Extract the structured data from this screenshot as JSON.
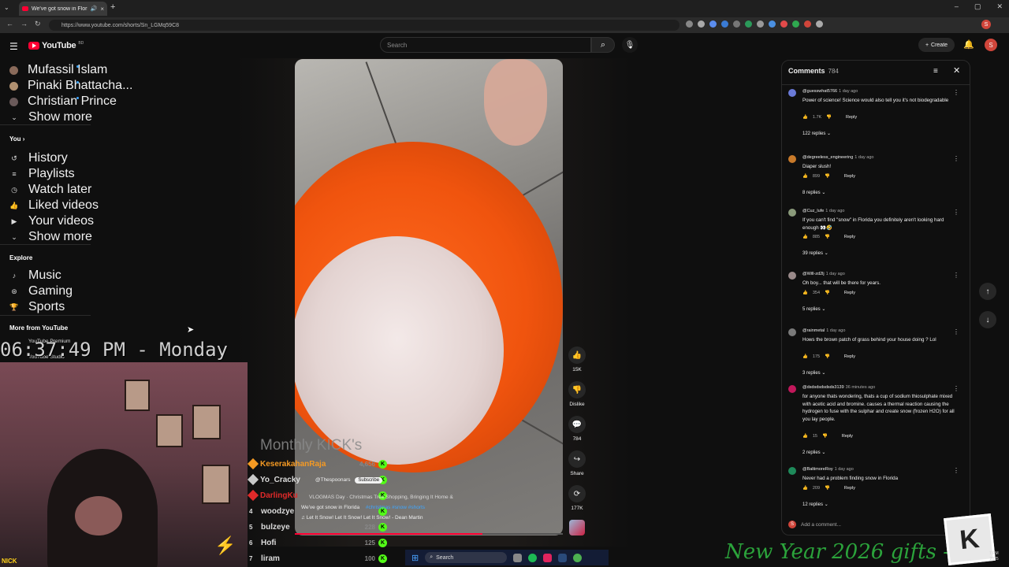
{
  "browser": {
    "tab_title": "We've got snow in Florida",
    "url": "https://www.youtube.com/shorts/Sn_LGMq59C8",
    "new_tab_icon": "plus",
    "profile_initial": "S"
  },
  "header": {
    "logo_text": "YouTube",
    "logo_country": "BD",
    "search_placeholder": "Search",
    "create_label": "Create",
    "avatar_initial": "S"
  },
  "sidebar": {
    "subscriptions": [
      {
        "name": "Mufassil Islam"
      },
      {
        "name": "Pinaki Bhattacha..."
      },
      {
        "name": "Christian Prince"
      }
    ],
    "show_more": "Show more",
    "you_heading": "You",
    "you_items": [
      {
        "label": "History",
        "icon": "history-icon"
      },
      {
        "label": "Playlists",
        "icon": "playlist-icon"
      },
      {
        "label": "Watch later",
        "icon": "clock-icon"
      },
      {
        "label": "Liked videos",
        "icon": "thumbs-up-icon"
      },
      {
        "label": "Your videos",
        "icon": "video-icon"
      }
    ],
    "show_more_2": "Show more",
    "explore_heading": "Explore",
    "explore_items": [
      {
        "label": "Music",
        "icon": "music-icon"
      },
      {
        "label": "Gaming",
        "icon": "gamepad-icon"
      },
      {
        "label": "Sports",
        "icon": "trophy-icon"
      }
    ],
    "more_heading": "More from YouTube",
    "more_items": [
      {
        "label": "YouTube Premium"
      },
      {
        "label": "YouTube Studio"
      }
    ]
  },
  "video": {
    "channel": "@Thespoonars",
    "subscribe": "Subscribe",
    "title": "We've got snow in Florida",
    "hashtags": "#christmas #snow #shorts",
    "playlist_line": "VLOGMAS Day · Christmas Tree Shopping, Bringing It Home &",
    "music": "Let It Snow! Let It Snow! Let It Snow! - Dean Martin",
    "progress": 0.7
  },
  "actions": {
    "like_count": "15K",
    "dislike_label": "Dislike",
    "comment_count": "784",
    "share_label": "Share",
    "remix_count": "177K"
  },
  "comments": {
    "title": "Comments",
    "count": "784",
    "add_placeholder": "Add a comment...",
    "items": [
      {
        "author": "@guesswhat5766",
        "ago": "1 day ago",
        "text": "Power of science! Science would also tell you it's not biodegradable",
        "likes": "1.7K",
        "replies": "122 replies",
        "avatar": "#6a7ad8"
      },
      {
        "author": "@degreeless_engineering",
        "ago": "1 day ago",
        "text": "Diaper slush!",
        "likes": "899",
        "replies": "8 replies",
        "avatar": "#c87a2a"
      },
      {
        "author": "@Cuz_lufe",
        "ago": "1 day ago",
        "text": "If you can't find \"snow\" in Florida you definitely aren't looking hard enough 👀🤣",
        "likes": "885",
        "replies": "39 replies",
        "avatar": "#8a9a7a"
      },
      {
        "author": "@Will-zd2lj",
        "ago": "1 day ago",
        "text": "Oh boy... that will be there for years.",
        "likes": "354",
        "replies": "5 replies",
        "avatar": "#9a8a8a"
      },
      {
        "author": "@rainmetal",
        "ago": "1 day ago",
        "text": "Hows the brown patch of grass behind your house doing ? Lol",
        "likes": "175",
        "replies": "3 replies",
        "avatar": "#7a7a7a"
      },
      {
        "author": "@dsdsdsdsdsds3139",
        "ago": "36 minutes ago",
        "text": "for anyone thats wondering, thats a cup of sodium thiosulphate mixed with acetic acid and bromine. causes a thermal reaction causing the hydrogen to fuse with the sulphar and create snow (frozen H2O) for all you lay people.",
        "likes": "15",
        "replies": "2 replies",
        "avatar": "#c2185b"
      },
      {
        "author": "@BaltimoreRoy",
        "ago": "1 day ago",
        "text": "Never had a problem finding snow in Florida",
        "likes": "209",
        "replies": "12 replies",
        "avatar": "#1e8a5a"
      }
    ]
  },
  "stream": {
    "clock": "06:37:49 PM - Monday",
    "nick": "NICK",
    "kick_title": "Monthly KICK's",
    "leaderboard": [
      {
        "rank": "",
        "name": "KeserakahanRaja",
        "amount": "4,656",
        "color": "#f59a23"
      },
      {
        "rank": "",
        "name": "Yo_Cracky",
        "amount": "",
        "color": "#c9c9c9"
      },
      {
        "rank": "",
        "name": "DarlingKu",
        "amount": "",
        "color": "#e02a2a"
      },
      {
        "rank": "4",
        "name": "woodzye",
        "amount": "",
        "color": ""
      },
      {
        "rank": "5",
        "name": "bulzeye",
        "amount": "228",
        "color": ""
      },
      {
        "rank": "6",
        "name": "Hofi",
        "amount": "125",
        "color": ""
      },
      {
        "rank": "7",
        "name": "liram",
        "amount": "100",
        "color": ""
      }
    ],
    "new_year": "New Year 2026 gifts --"
  },
  "taskbar": {
    "search": "Search",
    "time": "7 PM",
    "date": "2025"
  }
}
